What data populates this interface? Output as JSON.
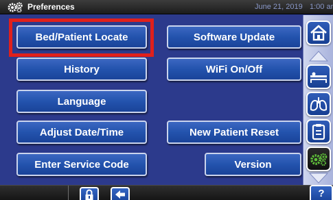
{
  "titlebar": {
    "title": "Preferences",
    "date": "June 21, 2019",
    "time": "1:00 am",
    "icon": "gears-icon"
  },
  "buttons": {
    "bed_patient_locate": "Bed/Patient Locate",
    "software_update": "Software Update",
    "history": "History",
    "wifi": "WiFi On/Off",
    "language": "Language",
    "adjust_date_time": "Adjust Date/Time",
    "new_patient_reset": "New Patient Reset",
    "enter_service_code": "Enter Service Code",
    "version": "Version"
  },
  "rail": {
    "items": [
      "home-icon",
      "bed-scale-icon",
      "lungs-icon",
      "clipboard-icon",
      "gears-icon"
    ],
    "active": "gears-icon"
  },
  "bottombar": {
    "items": [
      "lock-icon",
      "back-arrow-icon"
    ],
    "help_label": "?"
  },
  "colors": {
    "background": "#2c3a8c",
    "button": "#2353ad",
    "highlight": "#e0201c",
    "titlebar": "#2a2a2a"
  }
}
